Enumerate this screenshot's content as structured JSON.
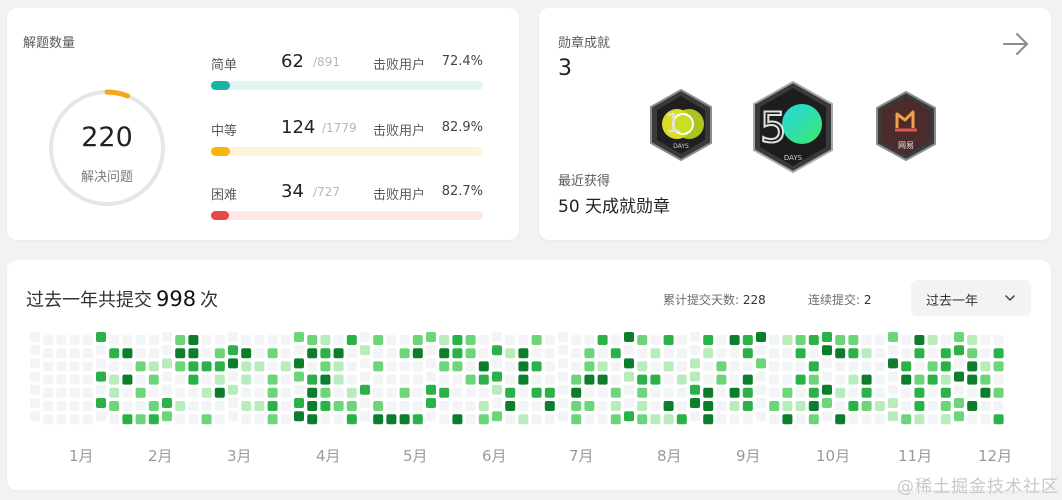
{
  "solved": {
    "title": "解题数量",
    "count": "220",
    "count_label": "解决问题",
    "ring_fraction": 0.06,
    "difficulties": [
      {
        "name": "简单",
        "solved": "62",
        "total": "/891",
        "beat_label": "击败用户",
        "beat_pct": "72.4%",
        "fill_fraction": 0.07,
        "color": "#15b4a4",
        "track": "#def6ef"
      },
      {
        "name": "中等",
        "solved": "124",
        "total": "/1779",
        "beat_label": "击败用户",
        "beat_pct": "82.9%",
        "fill_fraction": 0.07,
        "color": "#f9b40f",
        "track": "#fef4dc"
      },
      {
        "name": "困难",
        "solved": "34",
        "total": "/727",
        "beat_label": "击败用户",
        "beat_pct": "82.7%",
        "fill_fraction": 0.05,
        "color": "#e84848",
        "track": "#fde7e7"
      }
    ]
  },
  "badges": {
    "title": "勋章成就",
    "count": "3",
    "items": [
      {
        "name": "100-days-badge",
        "text": "100",
        "caption": "DAYS"
      },
      {
        "name": "50-days-badge",
        "text": "50",
        "caption": "DAYS"
      },
      {
        "name": "netease-badge",
        "text": "",
        "caption": "网易"
      }
    ],
    "recent_label": "最近获得",
    "recent_name": "50 天成就勋章"
  },
  "heatmap": {
    "title_prefix": "过去一年共提交",
    "total": "998",
    "title_suffix": "次",
    "days_label": "累计提交天数:",
    "days_value": "228",
    "streak_label": "连续提交:",
    "streak_value": "2",
    "range_label": "过去一年",
    "months": [
      "1月",
      "2月",
      "3月",
      "4月",
      "5月",
      "6月",
      "7月",
      "8月",
      "9月",
      "10月",
      "11月",
      "12月"
    ],
    "colors": {
      "empty": "#f3f4f5",
      "level1": "#b9ecbd",
      "level2": "#6cd579",
      "level3": "#2ab147",
      "level4": "#0b7d2b"
    }
  },
  "watermark": "@稀土掘金技术社区"
}
